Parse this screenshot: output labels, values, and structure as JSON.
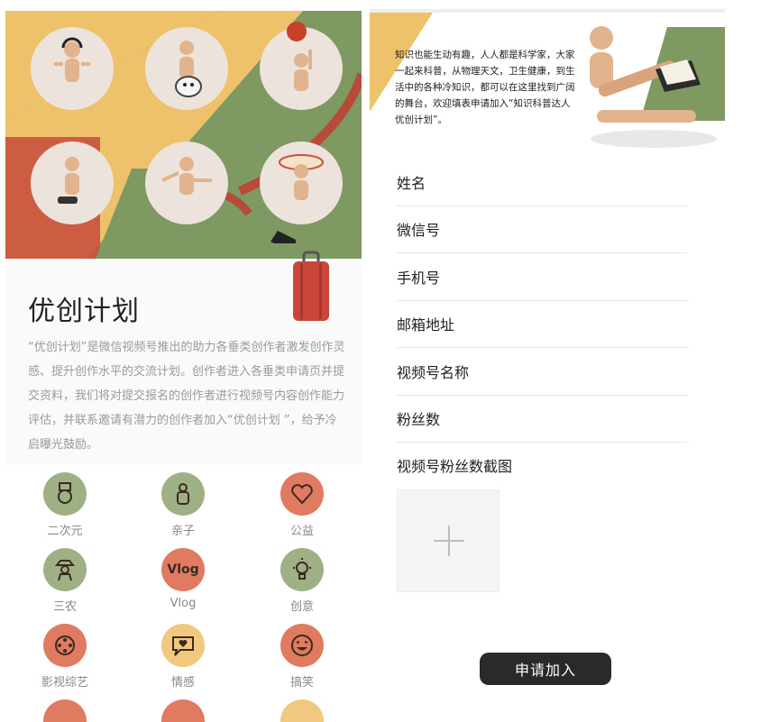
{
  "left_page": {
    "program_title": "优创计划",
    "program_description": "“优创计划”是微信视频号推出的助力各垂类创作者激发创作灵感、提升创作水平的交流计划。创作者进入各垂类申请页并提交资料，我们将对提交报名的创作者进行视频号内容创作能力评估，并联系邀请有潜力的创作者加入“优创计划 ”，给予冷启曝光鼓励。",
    "categories": [
      {
        "label": "二次元",
        "icon": "snowman-hat-icon",
        "color": "green"
      },
      {
        "label": "亲子",
        "icon": "mother-child-icon",
        "color": "green"
      },
      {
        "label": "公益",
        "icon": "heart-hands-icon",
        "color": "red"
      },
      {
        "label": "三农",
        "icon": "farmer-icon",
        "color": "green"
      },
      {
        "label": "Vlog",
        "icon": "vlog-text-icon",
        "color": "red",
        "icon_text": "Vlog"
      },
      {
        "label": "创意",
        "icon": "lightbulb-icon",
        "color": "green"
      },
      {
        "label": "影视综艺",
        "icon": "film-reel-icon",
        "color": "red"
      },
      {
        "label": "情感",
        "icon": "chat-heart-icon",
        "color": "yellow"
      },
      {
        "label": "搞笑",
        "icon": "laughing-face-icon",
        "color": "red"
      }
    ]
  },
  "right_page": {
    "intro_text": "知识也能生动有趣，人人都是科学家，大家一起来科普，从物理天文，卫生健康，到生活中的各种冷知识，都可以在这里找到广阔的舞台，欢迎填表申请加入“知识科普达人优创计划”。",
    "form_fields": [
      {
        "label": "姓名"
      },
      {
        "label": "微信号"
      },
      {
        "label": "手机号"
      },
      {
        "label": "邮箱地址"
      },
      {
        "label": "视频号名称"
      },
      {
        "label": "粉丝数"
      },
      {
        "label": "视频号粉丝数截图"
      }
    ],
    "upload_icon": "plus-icon",
    "submit_label": "申请加入"
  },
  "colors": {
    "hero_green": "#7e9a62",
    "hero_yellow": "#edc26a",
    "hero_red": "#c8523e",
    "category_green": "#9fb184",
    "category_red": "#e07a60",
    "category_yellow": "#f0c880",
    "button_dark": "#2a2a2a"
  }
}
